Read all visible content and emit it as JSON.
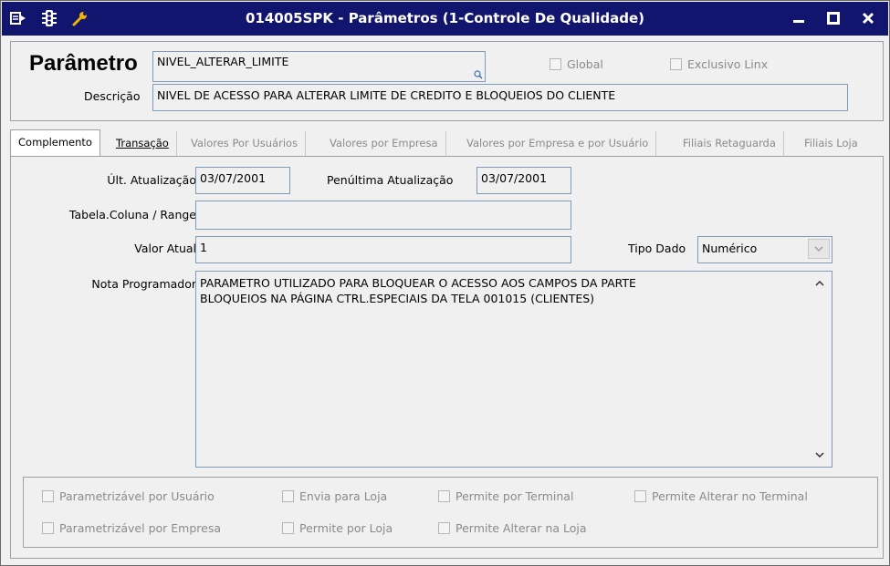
{
  "window": {
    "title": "014005SPK - Parâmetros (1-Controle De Qualidade)",
    "icons": [
      "menu-icon",
      "traffic-light-icon",
      "wrench-icon"
    ],
    "accent_color": "#12156e"
  },
  "header": {
    "param_label": "Parâmetro",
    "param_value": "NIVEL_ALTERAR_LIMITE",
    "global_label": "Global",
    "exclusivo_label": "Exclusivo Linx",
    "descricao_label": "Descrição",
    "descricao_value": "NIVEL DE ACESSO PARA ALTERAR LIMITE DE CREDITO E BLOQUEIOS DO CLIENTE"
  },
  "tabs": [
    {
      "label": "Complemento"
    },
    {
      "label": "Transação"
    },
    {
      "label": "Valores Por Usuários"
    },
    {
      "label": "Valores por Empresa"
    },
    {
      "label": "Valores por Empresa e por Usuário"
    },
    {
      "label": "Filiais Retaguarda"
    },
    {
      "label": "Filiais Loja"
    }
  ],
  "form": {
    "ult_atualizacao_label": "Últ. Atualização",
    "ult_atualizacao_value": "03/07/2001",
    "penultima_label": "Penúltima Atualização",
    "penultima_value": "03/07/2001",
    "tabela_label": "Tabela.Coluna / Range",
    "tabela_value": "",
    "valor_atual_label": "Valor Atual",
    "valor_atual_value": "1",
    "tipo_dado_label": "Tipo Dado",
    "tipo_dado_value": "Numérico",
    "nota_label": "Nota Programador",
    "nota_line1": "PARAMETRO UTILIZADO PARA BLOQUEAR O ACESSO AOS CAMPOS DA PARTE",
    "nota_line2": "BLOQUEIOS NA PÁGINA CTRL.ESPECIAIS DA TELA 001015 (CLIENTES)"
  },
  "options": {
    "parametrizavel_usuario": "Parametrizável por Usuário",
    "envia_loja": "Envia para Loja",
    "permite_terminal": "Permite por Terminal",
    "permite_alterar_terminal": "Permite Alterar no Terminal",
    "parametrizavel_empresa": "Parametrizável por Empresa",
    "permite_loja": "Permite por Loja",
    "permite_alterar_loja": "Permite Alterar na Loja"
  }
}
